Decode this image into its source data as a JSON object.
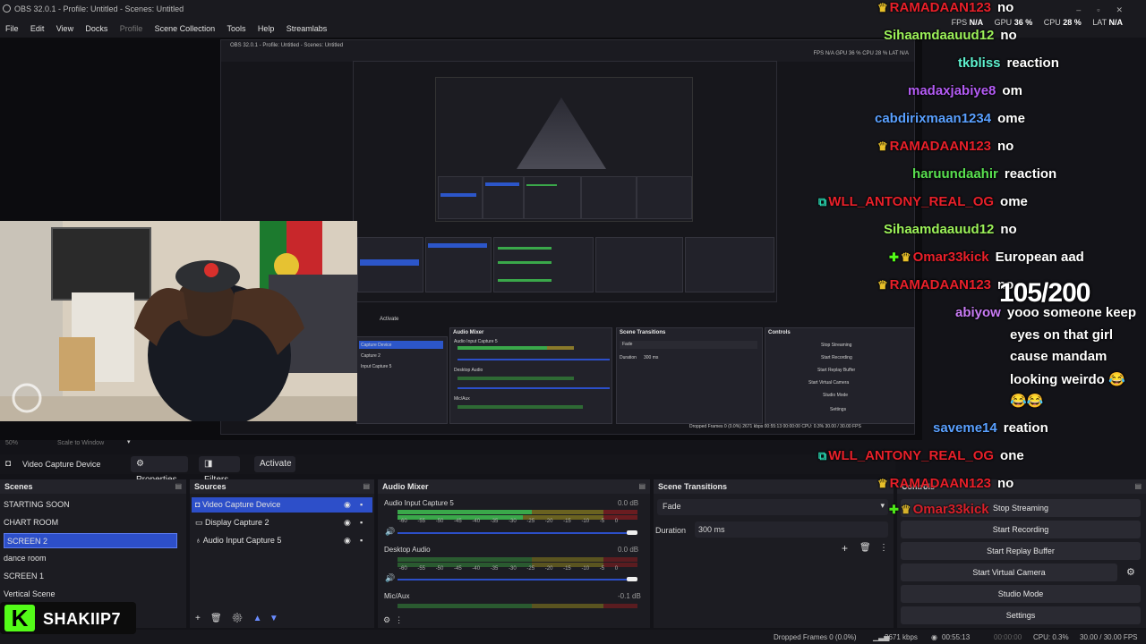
{
  "window": {
    "title": "OBS 32.0.1 - Profile: Untitled - Scenes: Untitled"
  },
  "menu": [
    "File",
    "Edit",
    "View",
    "Docks",
    "Profile",
    "Scene Collection",
    "Tools",
    "Help",
    "Streamlabs"
  ],
  "stats": {
    "fps_label": "FPS",
    "fps": "N/A",
    "gpu_label": "GPU",
    "gpu": "36 %",
    "cpu_label": "CPU",
    "cpu": "28 %",
    "lat_label": "LAT",
    "lat": "N/A"
  },
  "toolbar": {
    "zoom": "50%",
    "scale": "Scale to Window",
    "source": "Video Capture Device",
    "properties": "Properties",
    "filters": "Filters",
    "activate": "Activate"
  },
  "scenes": {
    "title": "Scenes",
    "items": [
      "STARTING SOON",
      "CHART ROOM",
      "SCREEN 2",
      "dance room",
      "SCREEN 1",
      "Vertical Scene"
    ],
    "selected": 2
  },
  "sources": {
    "title": "Sources",
    "items": [
      "Video Capture Device",
      "Display Capture 2",
      "Audio Input Capture 5"
    ]
  },
  "mixer": {
    "title": "Audio Mixer",
    "channels": [
      {
        "name": "Audio Input Capture 5",
        "db": "0.0 dB"
      },
      {
        "name": "Desktop Audio",
        "db": "0.0 dB"
      },
      {
        "name": "Mic/Aux",
        "db": "-0.1 dB"
      }
    ],
    "ticks": [
      "-60",
      "-55",
      "-50",
      "-45",
      "-40",
      "-35",
      "-30",
      "-25",
      "-20",
      "-15",
      "-10",
      "-5",
      "0"
    ]
  },
  "transitions": {
    "title": "Scene Transitions",
    "type": "Fade",
    "duration_label": "Duration",
    "duration": "300 ms"
  },
  "controls": {
    "title": "Controls",
    "buttons": [
      "Stop Streaming",
      "Start Recording",
      "Start Replay Buffer",
      "Start Virtual Camera",
      "Studio Mode",
      "Settings"
    ]
  },
  "status": {
    "dropped": "Dropped Frames 0 (0.0%)",
    "bitrate": "2671 kbps",
    "stream_time": "00:55:13",
    "rec_time": "00:00:00",
    "cpu": "CPU: 0.3%",
    "fps": "30.00 / 30.00 FPS"
  },
  "nested": {
    "title": "OBS 32.0.1 - Profile: Untitled - Scenes: Untitled",
    "stats": "FPS N/A   GPU 36 %   CPU 28 %   LAT N/A",
    "transitions": "Scene Transitions",
    "fade": "Fade",
    "duration": "Duration",
    "duration_val": "300 ms",
    "controls": "Controls",
    "buttons": [
      "Stop Streaming",
      "Start Recording",
      "Start Replay Buffer",
      "Start Virtual Camera",
      "Studio Mode",
      "Settings"
    ],
    "mixer": "Audio Mixer",
    "ch1": "Audio Input Capture 5",
    "ch2": "Desktop Audio",
    "ch3": "Mic/Aux",
    "activate": "Activate",
    "sources": [
      "Capture Device",
      "Capture 2",
      "Input Capture 5"
    ],
    "status": "Dropped Frames 0 (0.0%)  2671 kbps  00:55:13  00:00:00  CPU: 0.3%  30.00 / 30.00 FPS"
  },
  "chat": [
    {
      "user": "RAMADAAN123",
      "msg": "no",
      "color": "#e8202a",
      "badge": "crown"
    },
    {
      "user": "Sihaamdaauud12",
      "msg": "no",
      "color": "#9df25a",
      "badge": ""
    },
    {
      "user": "tkbliss",
      "msg": "reaction",
      "color": "#5ff2d0",
      "badge": ""
    },
    {
      "user": "madaxjabiye8",
      "msg": "om",
      "color": "#b45cf5",
      "badge": ""
    },
    {
      "user": "cabdirixmaan1234",
      "msg": "ome",
      "color": "#5aa0ff",
      "badge": ""
    },
    {
      "user": "RAMADAAN123",
      "msg": "no",
      "color": "#e8202a",
      "badge": "crown"
    },
    {
      "user": "haruundaahir",
      "msg": "reaction",
      "color": "#59e050",
      "badge": ""
    },
    {
      "user": "WLL_ANTONY_REAL_OG",
      "msg": "ome",
      "color": "#e8202a",
      "badge": "og"
    },
    {
      "user": "Sihaamdaauud12",
      "msg": "no",
      "color": "#9df25a",
      "badge": ""
    },
    {
      "user": "Omar33kick",
      "msg": "European aad",
      "color": "#e8202a",
      "badge": "plus-crown"
    },
    {
      "user": "RAMADAAN123",
      "msg": "no",
      "color": "#e8202a",
      "badge": "crown"
    },
    {
      "user": "abiyow",
      "msg": "yooo someone keep eyes on that girl cause mandam looking weirdo 😂 😂😂",
      "color": "#c97cf5",
      "badge": ""
    },
    {
      "user": "saveme14",
      "msg": "reation",
      "color": "#5aa0ff",
      "badge": ""
    },
    {
      "user": "WLL_ANTONY_REAL_OG",
      "msg": "one",
      "color": "#e8202a",
      "badge": "og"
    },
    {
      "user": "RAMADAAN123",
      "msg": "no",
      "color": "#e8202a",
      "badge": "crown"
    },
    {
      "user": "Omar33kick",
      "msg": "Stop Streaming",
      "color": "#e8202a",
      "badge": "plus-crown"
    }
  ],
  "abiyow_lines": [
    "yooo someone keep",
    "eyes on that girl",
    "cause mandam",
    "looking weirdo 😂",
    "😂😂"
  ],
  "counter": "105/200",
  "streamer": {
    "name": "SHAKIIP7",
    "logo": "K"
  },
  "colors": {
    "accent": "#2d4fc9",
    "meter_green": "#3aa84a",
    "meter_yellow": "#a89a2a",
    "meter_red": "#a8232a",
    "kick_green": "#53fc18"
  }
}
